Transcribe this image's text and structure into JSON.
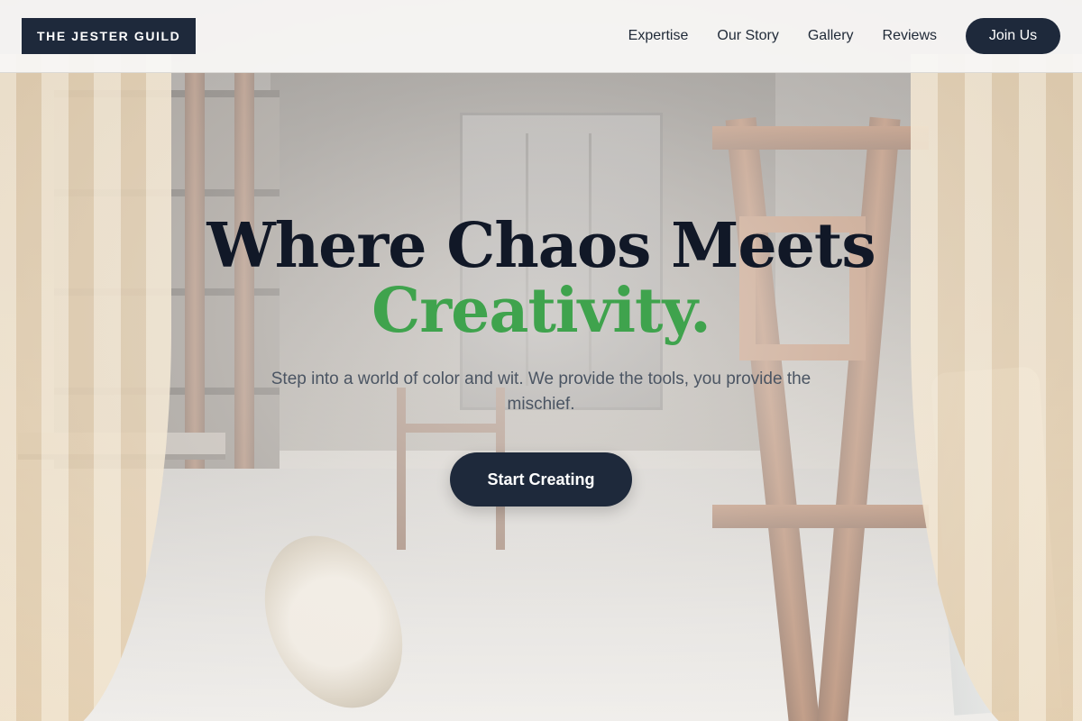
{
  "brand": {
    "logo_text": "THE JESTER GUILD"
  },
  "nav": {
    "links": [
      "Expertise",
      "Our Story",
      "Gallery",
      "Reviews"
    ],
    "cta_label": "Join Us"
  },
  "hero": {
    "headline": "Where Chaos Meets",
    "headline_accent": "Creativity.",
    "subtitle": "Step into a world of color and wit. We provide the tools, you provide the mischief.",
    "cta_label": "Start Creating",
    "background_image": "art-workshop-photo"
  },
  "colors": {
    "navy": "#1e293b",
    "accent_green": "#3fa34d",
    "headline": "#111827",
    "body_text": "#4b5563"
  }
}
